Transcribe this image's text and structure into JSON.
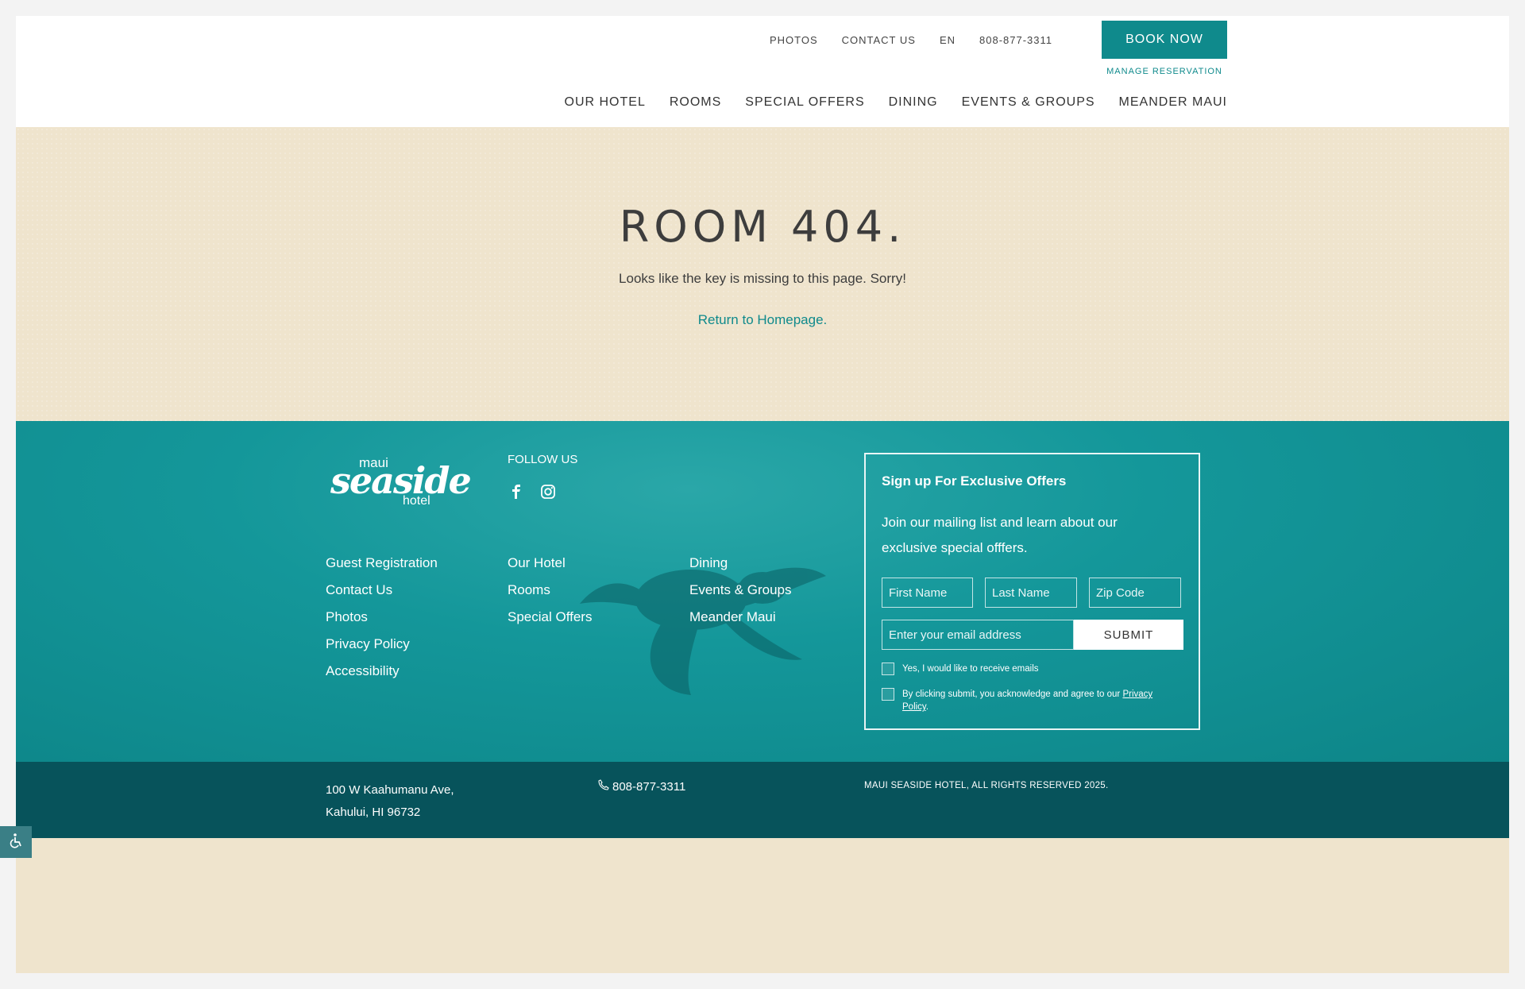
{
  "header": {
    "utility_links": [
      "PHOTOS",
      "CONTACT US",
      "EN",
      "808-877-3311"
    ],
    "book_label": "BOOK NOW",
    "manage_label": "MANAGE RESERVATION",
    "main_nav": [
      "OUR HOTEL",
      "ROOMS",
      "SPECIAL OFFERS",
      "DINING",
      "EVENTS & GROUPS",
      "MEANDER MAUI"
    ]
  },
  "hero": {
    "title": "ROOM 404.",
    "subtitle": "Looks like the key is missing to this page. Sorry!",
    "link": "Return to Homepage."
  },
  "footer": {
    "logo": {
      "maui": "maui",
      "seaside": "seaside",
      "hotel": "hotel"
    },
    "follow_label": "FOLLOW US",
    "social_icons": [
      "facebook-icon",
      "instagram-icon"
    ],
    "col1": [
      "Guest Registration",
      "Contact Us",
      "Photos",
      "Privacy Policy",
      "Accessibility"
    ],
    "col2": [
      "Our Hotel",
      "Rooms",
      "Special Offers"
    ],
    "col3": [
      "Dining",
      "Events & Groups",
      "Meander Maui"
    ],
    "signup": {
      "title": "Sign up For Exclusive Offers",
      "description": "Join our mailing list and learn about our exclusive special offfers.",
      "first_name_placeholder": "First Name",
      "last_name_placeholder": "Last Name",
      "zip_placeholder": "Zip Code",
      "email_placeholder": "Enter your email address",
      "submit_label": "SUBMIT",
      "check1_label": "Yes, I would like to receive emails",
      "check2_prefix": "By clicking submit, you acknowledge and agree to our ",
      "check2_link": "Privacy Policy",
      "check2_suffix": "."
    }
  },
  "bottom": {
    "address_line1": "100 W Kaahumanu Ave,",
    "address_line2": "Kahului, HI 96732",
    "phone": "808-877-3311",
    "copyright": "MAUI SEASIDE HOTEL, ALL RIGHTS RESERVED 2025."
  },
  "colors": {
    "teal": "#0f8a8c",
    "footer_dark": "#07535b",
    "sand": "#efe4cd"
  }
}
